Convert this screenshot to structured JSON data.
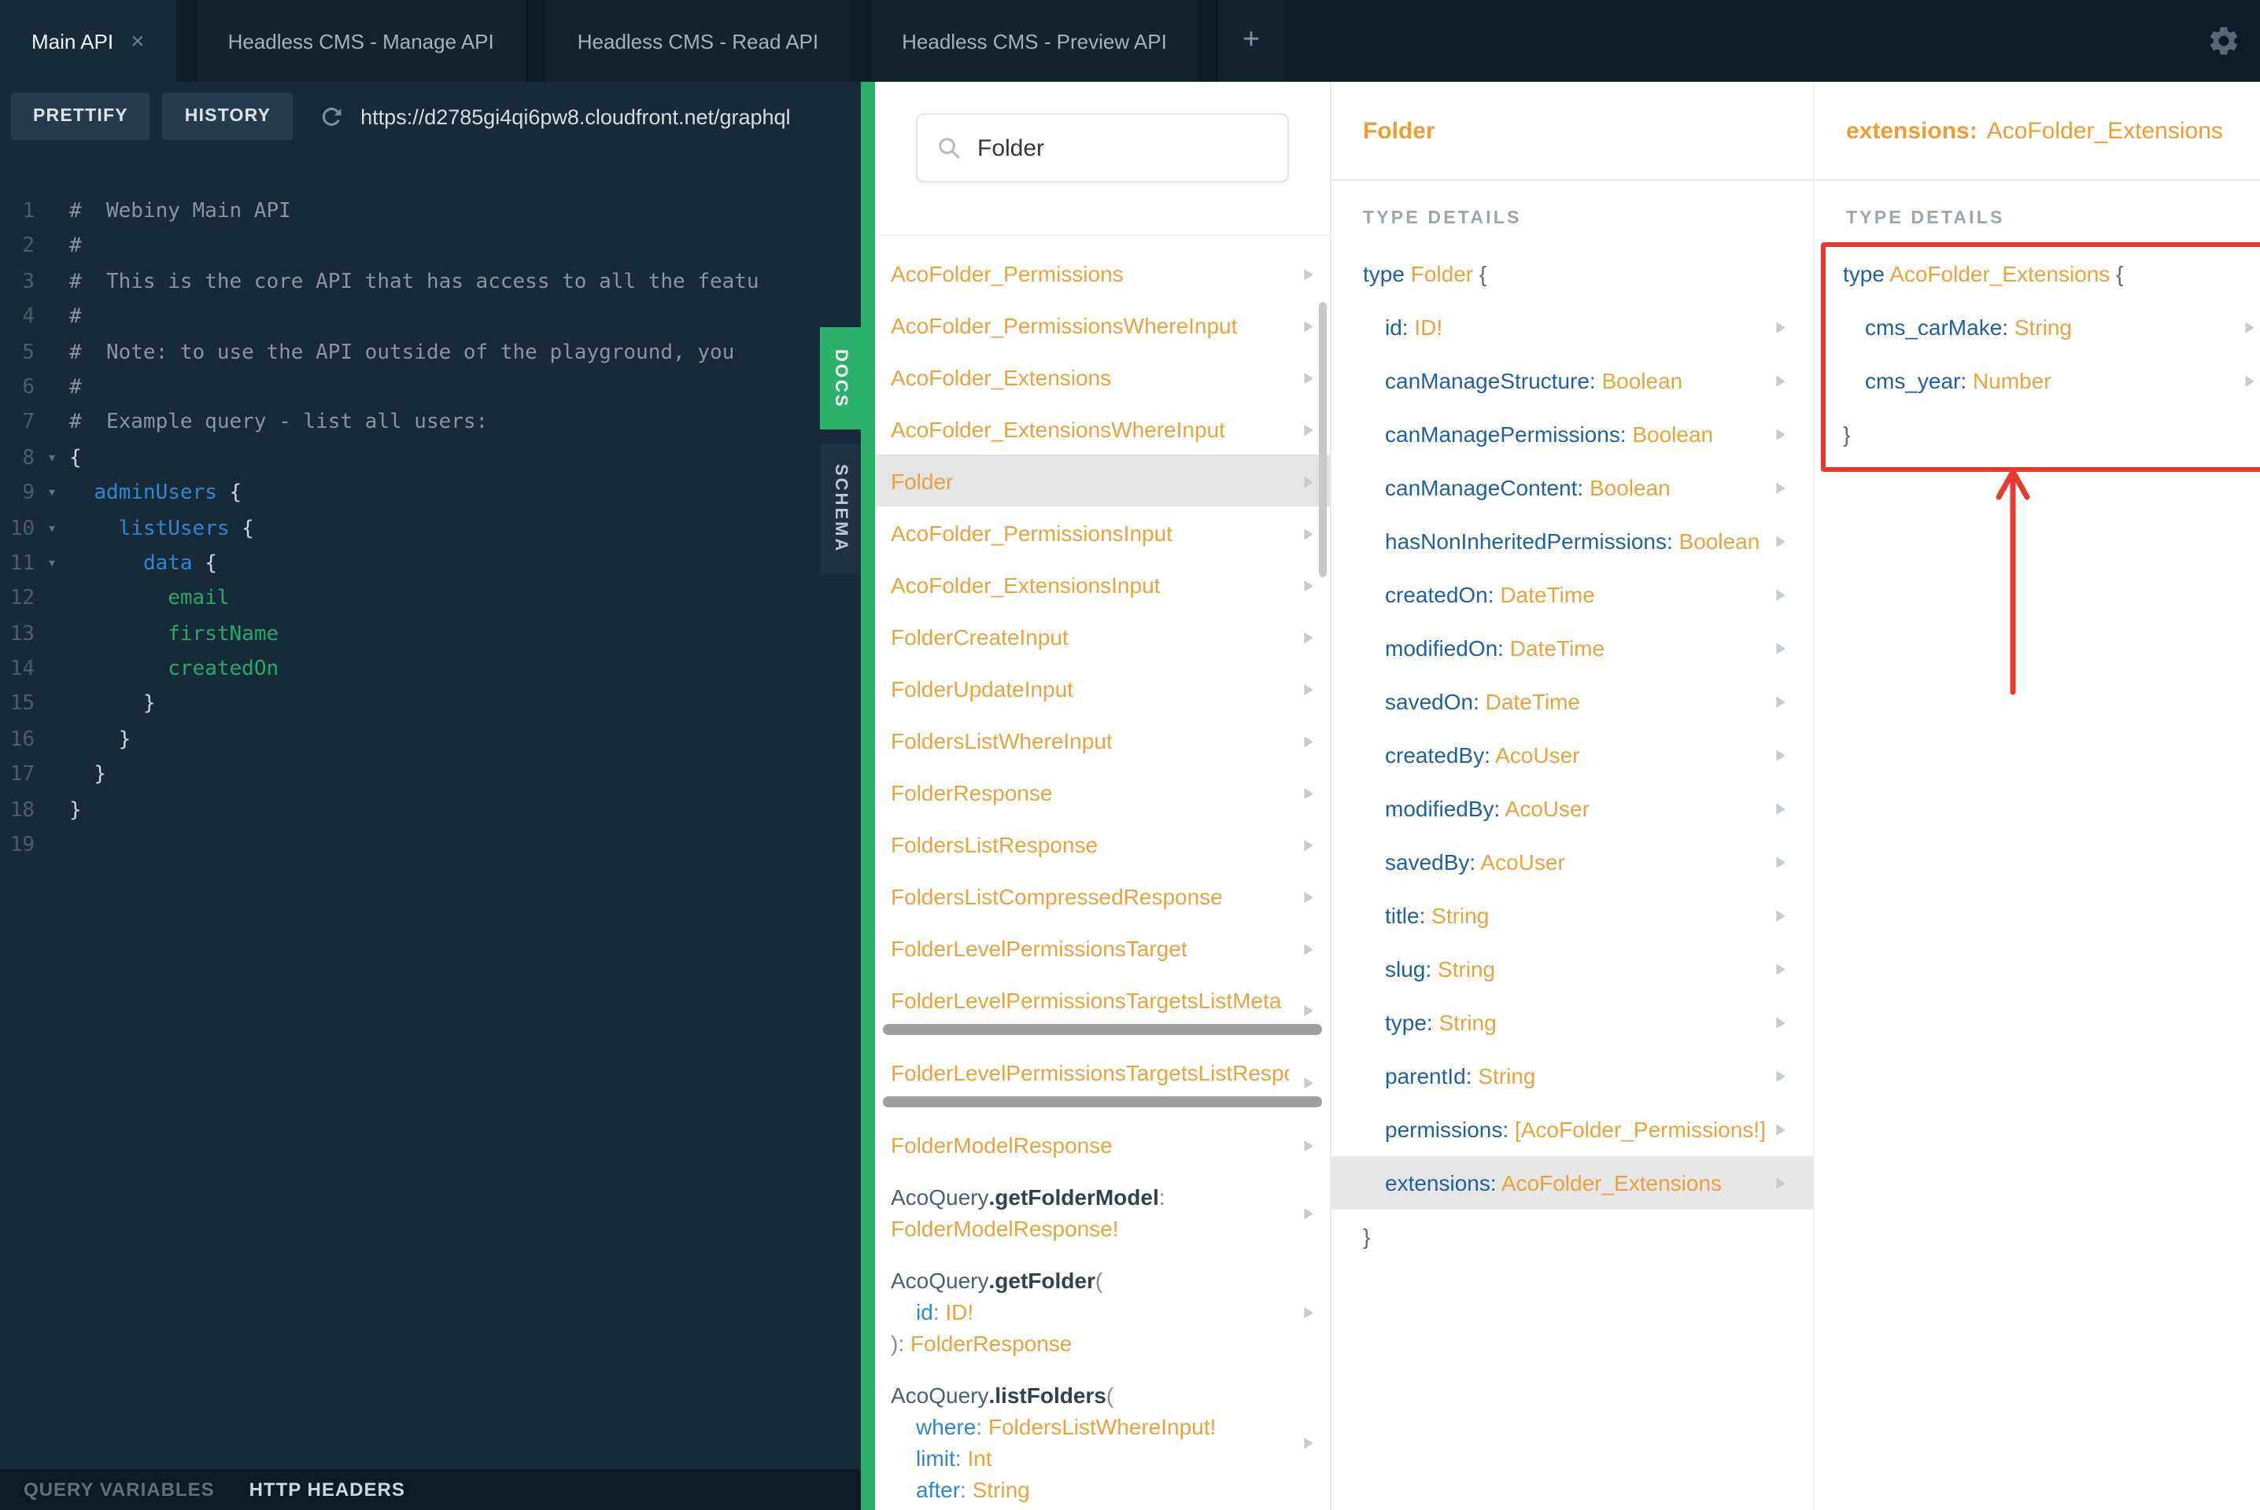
{
  "colors": {
    "green": "#2bb169",
    "orange": "#e8a33d",
    "field_blue": "#1f61a0",
    "annotation_red": "#e8392f",
    "editor_background": "#172a38",
    "selected_row": "#e4e4e4"
  },
  "tabs": {
    "add_label": "+",
    "items": [
      {
        "label": "Main API",
        "active": true,
        "closable": true
      },
      {
        "label": "Headless CMS - Manage API"
      },
      {
        "label": "Headless CMS - Read API"
      },
      {
        "label": "Headless CMS - Preview API"
      }
    ]
  },
  "toolbar": {
    "prettify_label": "PRETTIFY",
    "history_label": "HISTORY",
    "url": "https://d2785gi4qi6pw8.cloudfront.net/graphql"
  },
  "footer": {
    "query_variables": "QUERY VARIABLES",
    "http_headers": "HTTP HEADERS"
  },
  "side_tabs": {
    "docs": "DOCS",
    "schema": "SCHEMA"
  },
  "editor": {
    "lines": [
      {
        "n": 1,
        "seg": [
          [
            "comment",
            "#  Webiny Main API"
          ]
        ]
      },
      {
        "n": 2,
        "seg": [
          [
            "comment",
            "#"
          ]
        ]
      },
      {
        "n": 3,
        "seg": [
          [
            "comment",
            "#  This is the core API that has access to all the featu"
          ]
        ]
      },
      {
        "n": 4,
        "seg": [
          [
            "comment",
            "#"
          ]
        ]
      },
      {
        "n": 5,
        "seg": [
          [
            "comment",
            "#  Note: to use the API outside of the playground, you"
          ]
        ]
      },
      {
        "n": 6,
        "seg": [
          [
            "comment",
            "#"
          ]
        ]
      },
      {
        "n": 7,
        "seg": [
          [
            "comment",
            "#  Example query - list all users:"
          ]
        ]
      },
      {
        "n": 8,
        "fold": true,
        "seg": [
          [
            "brace",
            "{"
          ]
        ]
      },
      {
        "n": 9,
        "fold": true,
        "seg": [
          [
            "plain",
            "  "
          ],
          [
            "field",
            "adminUsers"
          ],
          [
            "brace",
            " {"
          ]
        ]
      },
      {
        "n": 10,
        "fold": true,
        "seg": [
          [
            "plain",
            "    "
          ],
          [
            "field",
            "listUsers"
          ],
          [
            "brace",
            " {"
          ]
        ]
      },
      {
        "n": 11,
        "fold": true,
        "seg": [
          [
            "plain",
            "      "
          ],
          [
            "field",
            "data"
          ],
          [
            "brace",
            " {"
          ]
        ]
      },
      {
        "n": 12,
        "seg": [
          [
            "plain",
            "        "
          ],
          [
            "leaf",
            "email"
          ]
        ]
      },
      {
        "n": 13,
        "seg": [
          [
            "plain",
            "        "
          ],
          [
            "leaf",
            "firstName"
          ]
        ]
      },
      {
        "n": 14,
        "seg": [
          [
            "plain",
            "        "
          ],
          [
            "leaf",
            "createdOn"
          ]
        ]
      },
      {
        "n": 15,
        "seg": [
          [
            "plain",
            "      "
          ],
          [
            "brace",
            "}"
          ]
        ]
      },
      {
        "n": 16,
        "seg": [
          [
            "plain",
            "    "
          ],
          [
            "brace",
            "}"
          ]
        ]
      },
      {
        "n": 17,
        "seg": [
          [
            "plain",
            "  "
          ],
          [
            "brace",
            "}"
          ]
        ]
      },
      {
        "n": 18,
        "seg": [
          [
            "brace",
            "}"
          ]
        ]
      },
      {
        "n": 19,
        "seg": []
      }
    ]
  },
  "docs": {
    "search_value": "Folder",
    "items": [
      {
        "rows": [
          {
            "seg": [
              [
                "type",
                "AcoFolder_Permissions"
              ]
            ]
          }
        ]
      },
      {
        "rows": [
          {
            "seg": [
              [
                "type",
                "AcoFolder_PermissionsWhereInput"
              ]
            ]
          }
        ]
      },
      {
        "rows": [
          {
            "seg": [
              [
                "type",
                "AcoFolder_Extensions"
              ]
            ]
          }
        ]
      },
      {
        "rows": [
          {
            "seg": [
              [
                "type",
                "AcoFolder_ExtensionsWhereInput"
              ]
            ]
          }
        ]
      },
      {
        "selected": true,
        "rows": [
          {
            "seg": [
              [
                "type",
                "Folder"
              ]
            ]
          }
        ]
      },
      {
        "rows": [
          {
            "seg": [
              [
                "type",
                "AcoFolder_PermissionsInput"
              ]
            ]
          }
        ]
      },
      {
        "rows": [
          {
            "seg": [
              [
                "type",
                "AcoFolder_ExtensionsInput"
              ]
            ]
          }
        ]
      },
      {
        "rows": [
          {
            "seg": [
              [
                "type",
                "FolderCreateInput"
              ]
            ]
          }
        ]
      },
      {
        "rows": [
          {
            "seg": [
              [
                "type",
                "FolderUpdateInput"
              ]
            ]
          }
        ]
      },
      {
        "rows": [
          {
            "seg": [
              [
                "type",
                "FoldersListWhereInput"
              ]
            ]
          }
        ]
      },
      {
        "rows": [
          {
            "seg": [
              [
                "type",
                "FolderResponse"
              ]
            ]
          }
        ]
      },
      {
        "rows": [
          {
            "seg": [
              [
                "type",
                "FoldersListResponse"
              ]
            ]
          }
        ]
      },
      {
        "rows": [
          {
            "seg": [
              [
                "type",
                "FoldersListCompressedResponse"
              ]
            ]
          }
        ]
      },
      {
        "rows": [
          {
            "seg": [
              [
                "type",
                "FolderLevelPermissionsTarget"
              ]
            ]
          }
        ]
      },
      {
        "hscroll": true,
        "rows": [
          {
            "seg": [
              [
                "type",
                "FolderLevelPermissionsTargetsListMeta"
              ]
            ]
          }
        ]
      },
      {
        "hscroll": true,
        "rows": [
          {
            "seg": [
              [
                "type",
                "FolderLevelPermissionsTargetsListResponse"
              ]
            ]
          }
        ]
      },
      {
        "rows": [
          {
            "seg": [
              [
                "type",
                "FolderModelResponse"
              ]
            ]
          }
        ]
      },
      {
        "rows": [
          {
            "seg": [
              [
                "parent",
                "AcoQuery"
              ],
              [
                "method",
                ".getFolderModel"
              ],
              [
                "punct",
                ":"
              ]
            ]
          },
          {
            "seg": [
              [
                "type",
                "FolderModelResponse!"
              ]
            ]
          }
        ]
      },
      {
        "rows": [
          {
            "seg": [
              [
                "parent",
                "AcoQuery"
              ],
              [
                "method",
                ".getFolder"
              ],
              [
                "punct",
                "("
              ]
            ]
          },
          {
            "ind": true,
            "seg": [
              [
                "field",
                "id"
              ],
              [
                "punct",
                ": "
              ],
              [
                "type",
                "ID!"
              ]
            ]
          },
          {
            "seg": [
              [
                "punct",
                "): "
              ],
              [
                "type",
                "FolderResponse"
              ]
            ]
          }
        ]
      },
      {
        "rows": [
          {
            "seg": [
              [
                "parent",
                "AcoQuery"
              ],
              [
                "method",
                ".listFolders"
              ],
              [
                "punct",
                "("
              ]
            ]
          },
          {
            "ind": true,
            "seg": [
              [
                "field",
                "where"
              ],
              [
                "punct",
                ": "
              ],
              [
                "type",
                "FoldersListWhereInput!"
              ]
            ]
          },
          {
            "ind": true,
            "seg": [
              [
                "field",
                "limit"
              ],
              [
                "punct",
                ": "
              ],
              [
                "type",
                "Int"
              ]
            ]
          },
          {
            "ind": true,
            "seg": [
              [
                "field",
                "after"
              ],
              [
                "punct",
                ": "
              ],
              [
                "type",
                "String"
              ]
            ]
          }
        ]
      }
    ]
  },
  "folder_type": {
    "header": "Folder",
    "section_label": "TYPE DETAILS",
    "keyword": "type",
    "name": "Folder",
    "close": "}",
    "fields": [
      {
        "name": "id",
        "type": "ID!"
      },
      {
        "name": "canManageStructure",
        "type": "Boolean"
      },
      {
        "name": "canManagePermissions",
        "type": "Boolean"
      },
      {
        "name": "canManageContent",
        "type": "Boolean"
      },
      {
        "name": "hasNonInheritedPermissions",
        "type": "Boolean"
      },
      {
        "name": "createdOn",
        "type": "DateTime"
      },
      {
        "name": "modifiedOn",
        "type": "DateTime"
      },
      {
        "name": "savedOn",
        "type": "DateTime"
      },
      {
        "name": "createdBy",
        "type": "AcoUser"
      },
      {
        "name": "modifiedBy",
        "type": "AcoUser"
      },
      {
        "name": "savedBy",
        "type": "AcoUser"
      },
      {
        "name": "title",
        "type": "String"
      },
      {
        "name": "slug",
        "type": "String"
      },
      {
        "name": "type",
        "type": "String"
      },
      {
        "name": "parentId",
        "type": "String"
      },
      {
        "name": "permissions",
        "type": "[AcoFolder_Permissions!]"
      },
      {
        "name": "extensions",
        "type": "AcoFolder_Extensions",
        "selected": true
      }
    ]
  },
  "extensions_type": {
    "header_field": "extensions:",
    "header_type": "AcoFolder_Extensions",
    "section_label": "TYPE DETAILS",
    "keyword": "type",
    "name": "AcoFolder_Extensions",
    "close": "}",
    "fields": [
      {
        "name": "cms_carMake",
        "type": "String"
      },
      {
        "name": "cms_year",
        "type": "Number"
      }
    ]
  }
}
